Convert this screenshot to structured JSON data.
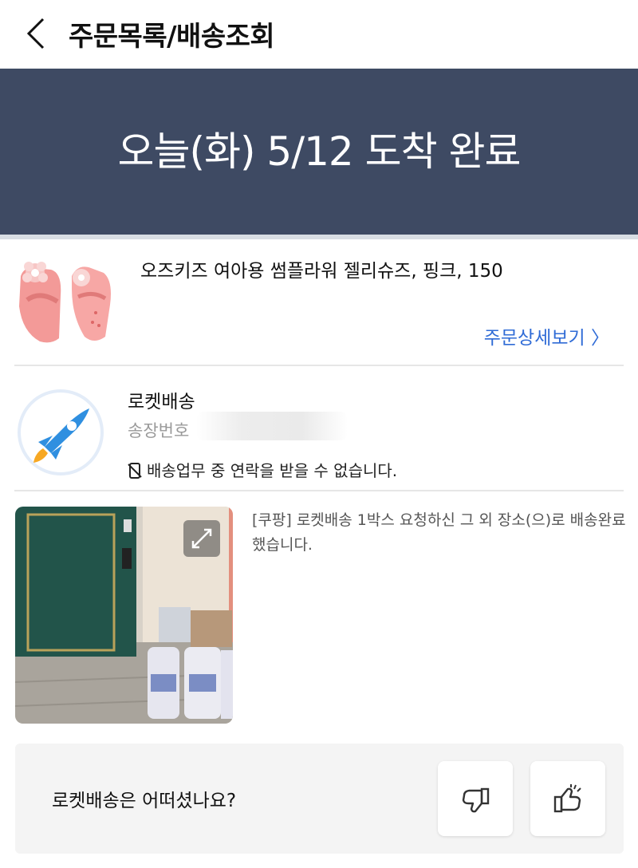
{
  "header": {
    "title": "주문목록/배송조회",
    "back_icon": "chevron-left-icon"
  },
  "banner": {
    "status": "오늘(화) 5/12 도착 완료",
    "color": "#3e4a63"
  },
  "product": {
    "name": "오즈키즈 여아용 썸플라워 젤리슈즈, 핑크, 150",
    "detail_link": "주문상세보기 〉",
    "link_color": "#2f6bd6"
  },
  "delivery": {
    "carrier": "로켓배송",
    "invoice_label": "송장번호",
    "notice": "배송업무 중 연락을 받을 수 없습니다.",
    "notice_icon": "no-phone-icon",
    "carrier_icon": "rocket-icon"
  },
  "proof": {
    "message": "[쿠팡] 로켓배송 1박스 요청하신 그 외 장소(으)로 배송완료했습니다.",
    "expand_icon": "expand-icon"
  },
  "feedback": {
    "question": "로켓배송은 어떠셨나요?",
    "dislike_icon": "thumbs-down-icon",
    "like_icon": "thumbs-up-icon"
  }
}
